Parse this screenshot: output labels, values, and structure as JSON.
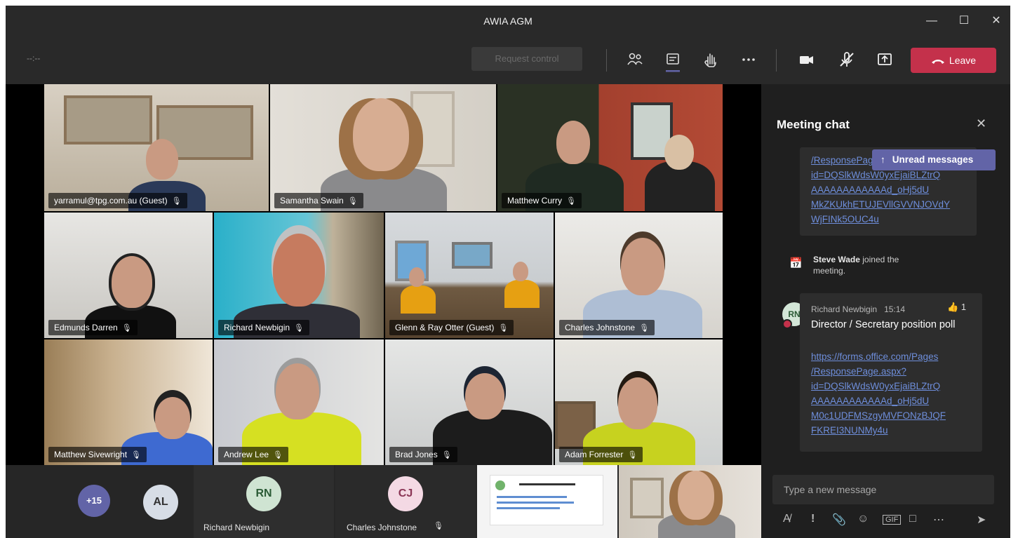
{
  "window": {
    "title": "AWIA AGM"
  },
  "toolbar": {
    "timer": "--:--",
    "request_control": "Request control",
    "leave_label": "Leave",
    "icons": [
      "people-icon",
      "chat-icon",
      "raise-hand-icon",
      "more-icon",
      "camera-icon",
      "mic-muted-icon",
      "share-icon"
    ]
  },
  "participants": [
    {
      "name": "yarramul@tpg.com.au (Guest)"
    },
    {
      "name": "Samantha Swain"
    },
    {
      "name": "Matthew Curry"
    },
    {
      "name": "Edmunds Darren"
    },
    {
      "name": "Richard Newbigin"
    },
    {
      "name": "Glenn & Ray Otter (Guest)"
    },
    {
      "name": "Charles Johnstone"
    },
    {
      "name": "Matthew Sivewright"
    },
    {
      "name": "Andrew Lee"
    },
    {
      "name": "Brad Jones"
    },
    {
      "name": "Adam Forrester"
    }
  ],
  "strip": {
    "overflow": "+15",
    "avatars": [
      {
        "initials": "AL",
        "name": ""
      },
      {
        "initials": "RN",
        "name": "Richard Newbigin"
      },
      {
        "initials": "CJ",
        "name": "Charles Johnstone"
      }
    ]
  },
  "chat": {
    "title": "Meeting chat",
    "unread": "Unread messages",
    "prev_link_lines": [
      "/ResponsePage.aspx?",
      "id=DQSlkWdsW0yxEjaiBLZtrQ",
      "AAAAAAAAAAAAd_oHj5dU",
      "MkZKUkhETUJEVllGVVNJOVdY",
      "WjFINk5OUC4u"
    ],
    "system": {
      "actor": "Steve Wade",
      "text": "joined the meeting."
    },
    "message": {
      "initials": "RN",
      "author": "Richard Newbigin",
      "time": "15:14",
      "reaction": "1",
      "text": "Director / Secretary position poll",
      "link_lines": [
        "https://forms.office.com/Pages",
        "/ResponsePage.aspx?",
        "id=DQSlkWdsW0yxEjaiBLZtrQ",
        "AAAAAAAAAAAAd_oHj5dU",
        "M0c1UDFMSzgyMVFONzBJQF",
        "FKREI3NUNMy4u"
      ]
    },
    "compose_placeholder": "Type a new message"
  }
}
